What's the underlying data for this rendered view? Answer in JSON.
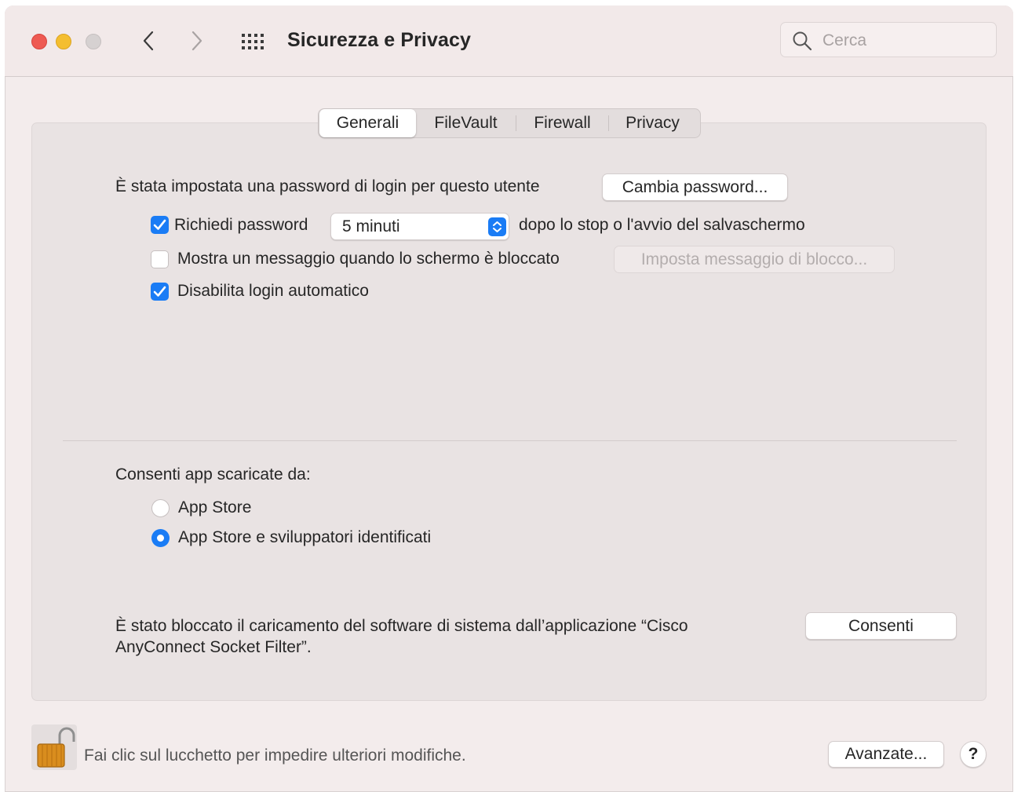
{
  "window": {
    "title": "Sicurezza e Privacy",
    "search_placeholder": "Cerca"
  },
  "tabs": [
    {
      "label": "Generali",
      "selected": true
    },
    {
      "label": "FileVault",
      "selected": false
    },
    {
      "label": "Firewall",
      "selected": false
    },
    {
      "label": "Privacy",
      "selected": false
    }
  ],
  "general": {
    "password_set_text": "È stata impostata una password di login per questo utente",
    "change_password_button": "Cambia password...",
    "require_password": {
      "label": "Richiedi password",
      "checked": true
    },
    "require_delay": "5 minuti",
    "require_suffix": "dopo lo stop o l'avvio del salvaschermo",
    "show_message": {
      "label": "Mostra un messaggio quando lo schermo è bloccato",
      "checked": false
    },
    "set_lock_message_button": "Imposta messaggio di blocco...",
    "disable_auto_login": {
      "label": "Disabilita login automatico",
      "checked": true
    }
  },
  "downloads": {
    "heading": "Consenti app scaricate da:",
    "options": [
      {
        "label": "App Store",
        "selected": false
      },
      {
        "label": "App Store e sviluppatori identificati",
        "selected": true
      }
    ]
  },
  "blocked": {
    "line1": "È stato bloccato il caricamento del software di sistema dall’applicazione “Cisco",
    "line2": "AnyConnect Socket Filter”.",
    "allow_button": "Consenti"
  },
  "footer": {
    "lock_text": "Fai clic sul lucchetto per impedire ulteriori modifiche.",
    "advanced_button": "Avanzate...",
    "help_label": "?"
  },
  "colors": {
    "accent": "#1a7cf5",
    "close": "#ee5a52",
    "minimize": "#f4be30",
    "zoom_disabled": "#d6d1d1"
  },
  "icons": [
    "close-icon",
    "minimize-icon",
    "zoom-icon",
    "chevron-left-icon",
    "chevron-right-icon",
    "grid-icon",
    "search-icon",
    "checkmark-icon",
    "stepper-icon",
    "padlock-open-icon",
    "help-icon"
  ]
}
